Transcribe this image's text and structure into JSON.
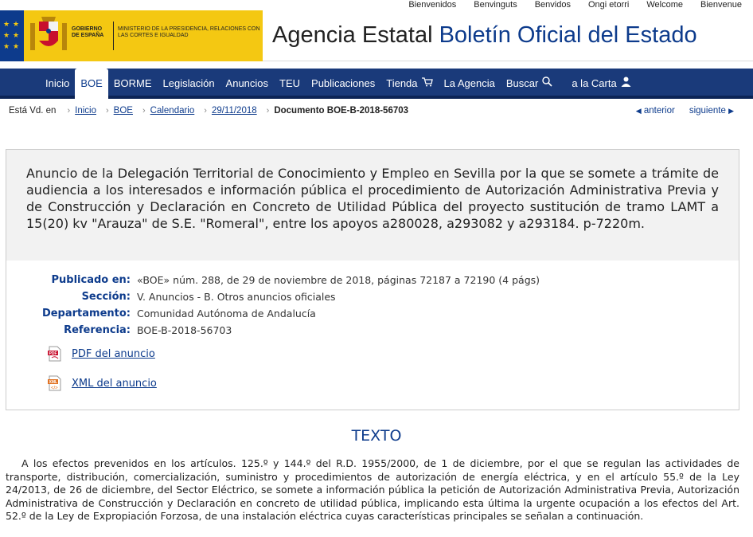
{
  "languages": [
    "Bienvenidos",
    "Benvinguts",
    "Benvidos",
    "Ongi etorri",
    "Welcome",
    "Bienvenue"
  ],
  "header": {
    "gov_text": "GOBIERNO DE ESPAÑA",
    "ministry_text": "MINISTERIO DE LA PRESIDENCIA, RELACIONES CON LAS CORTES E IGUALDAD",
    "brand_prefix": "Agencia Estatal",
    "brand_main": "Boletín Oficial del Estado",
    "colors": {
      "band": "#f4c812",
      "eu": "#0d3b8c",
      "nav": "#1a3a7a",
      "accent": "#0d3b8c"
    }
  },
  "nav": {
    "items": [
      {
        "label": "Inicio"
      },
      {
        "label": "BOE",
        "active": true
      },
      {
        "label": "BORME"
      },
      {
        "label": "Legislación"
      },
      {
        "label": "Anuncios"
      },
      {
        "label": "TEU"
      },
      {
        "label": "Publicaciones"
      },
      {
        "label": "Tienda",
        "icon": "cart-icon"
      },
      {
        "label": "La Agencia"
      },
      {
        "label": "Buscar",
        "icon": "search-icon"
      },
      {
        "label": "a la Carta",
        "icon": "user-icon"
      }
    ]
  },
  "breadcrumb": {
    "prefix": "Está Vd. en",
    "links": [
      "Inicio",
      "BOE",
      "Calendario",
      "29/11/2018"
    ],
    "current": "Documento BOE-B-2018-56703",
    "prev": "anterior",
    "next": "siguiente"
  },
  "document": {
    "title": "Anuncio de la Delegación Territorial de Conocimiento y Empleo en Sevilla por la que se somete a trámite de audiencia a los interesados e información pública el procedimiento de Autorización Administrativa Previa y de Construcción y Declaración en Concreto de Utilidad Pública del proyecto sustitución de tramo LAMT a 15(20) kv \"Arauza\" de S.E. \"Romeral\", entre los apoyos a280028, a293082 y a293184. p-7220m.",
    "meta": [
      {
        "key": "Publicado en:",
        "value": "«BOE» núm. 288, de 29 de noviembre de 2018, páginas 72187 a 72190 (4 págs)"
      },
      {
        "key": "Sección:",
        "value": "V. Anuncios - B. Otros anuncios oficiales"
      },
      {
        "key": "Departamento:",
        "value": "Comunidad Autónoma de Andalucía"
      },
      {
        "key": "Referencia:",
        "value": "BOE-B-2018-56703"
      }
    ],
    "downloads": [
      {
        "label": "PDF del anuncio",
        "icon": "pdf-file-icon"
      },
      {
        "label": "XML del anuncio",
        "icon": "xml-file-icon"
      }
    ],
    "section_title": "TEXTO",
    "body": "A los efectos prevenidos en los artículos. 125.º y 144.º del R.D. 1955/2000, de 1 de diciembre, por el que se regulan las actividades de transporte, distribución, comercialización, suministro y procedimientos de autorización de energía eléctrica, y en el artículo 55.º de la Ley 24/2013, de 26 de diciembre, del Sector Eléctrico, se somete a información pública la petición de Autorización Administrativa Previa, Autorización Administrativa de Construcción y Declaración en concreto de utilidad pública, implicando esta última la urgente ocupación a los efectos del Art. 52.º de la Ley de Expropiación Forzosa, de una instalación eléctrica cuyas características principales se señalan a continuación."
  }
}
